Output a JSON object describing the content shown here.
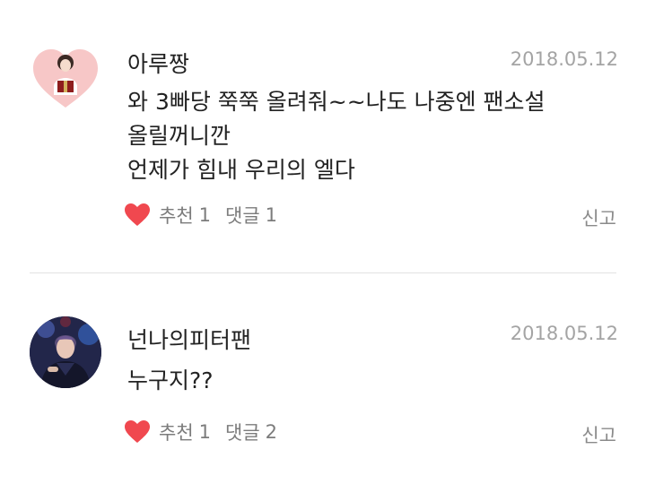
{
  "comments": [
    {
      "username": "아루짱",
      "date": "2018.05.12",
      "lines": [
        "와 3빠당 쭉쭉 올려줘~~나도 나중엔 팬소설",
        "올릴꺼니깐",
        "언제가 힘내 우리의 엘다"
      ],
      "like_label": "추천",
      "like_count": "1",
      "reply_label": "댓글",
      "reply_count": "1",
      "report_label": "신고"
    },
    {
      "username": "넌나의피터팬",
      "date": "2018.05.12",
      "lines": [
        "누구지??"
      ],
      "like_label": "추천",
      "like_count": "1",
      "reply_label": "댓글",
      "reply_count": "2",
      "report_label": "신고"
    }
  ],
  "colors": {
    "heart": "#f0484f",
    "meta_text": "#a4a4a4",
    "action_text": "#7c7c7c",
    "divider": "#e2e2e2"
  },
  "icons": {
    "like": "heart-icon",
    "avatar_1": "heart-frame-avatar",
    "avatar_2": "photo-avatar"
  }
}
